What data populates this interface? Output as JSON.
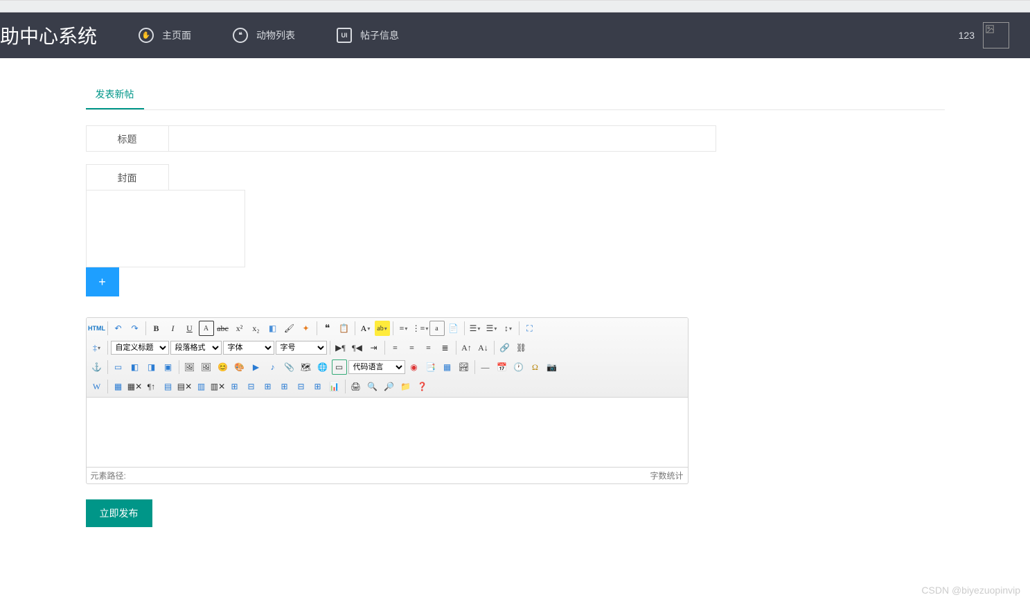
{
  "header": {
    "brand": "助中心系统",
    "nav": [
      {
        "label": "主页面"
      },
      {
        "label": "动物列表"
      },
      {
        "label": "帖子信息"
      }
    ],
    "user_id": "123"
  },
  "tabs": {
    "active": "发表新帖"
  },
  "form": {
    "title_label": "标题",
    "title_value": "",
    "cover_label": "封面",
    "plus": "+"
  },
  "editor": {
    "selects": {
      "custom_title": "自定义标题",
      "paragraph": "段落格式",
      "font_family": "字体",
      "font_size": "字号",
      "code_lang": "代码语言"
    },
    "footer_left": "元素路径:",
    "footer_right": "字数统计"
  },
  "actions": {
    "publish": "立即发布"
  },
  "watermark": "CSDN @biyezuopinvip"
}
